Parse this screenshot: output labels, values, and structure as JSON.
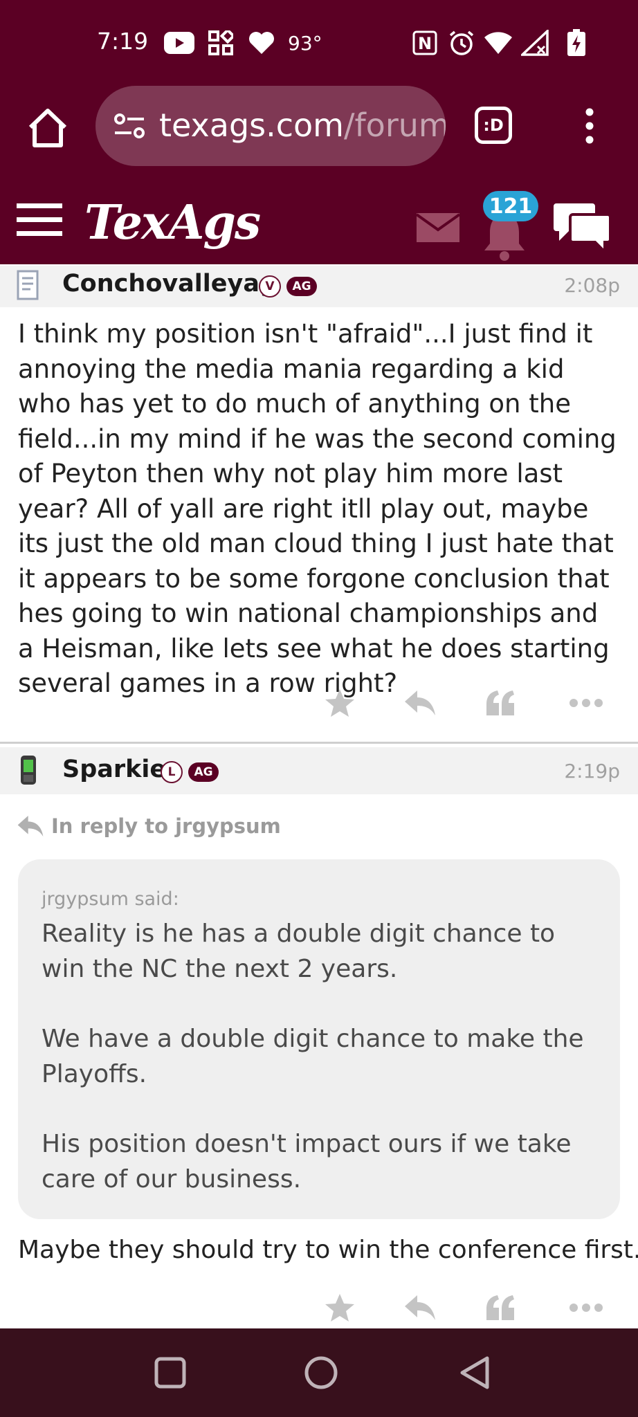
{
  "status_bar": {
    "time": "7:19",
    "temperature": "93°"
  },
  "browser": {
    "url_domain": "texags.com",
    "url_path": "/forum",
    "tab_label": ":D"
  },
  "app": {
    "logo": "TexAgs",
    "notification_count": "121"
  },
  "posts": [
    {
      "username": "Conchovalleyag",
      "badge_letter": "V",
      "badge_tag": "AG",
      "time": "2:08p",
      "body": "I think my position isn't \"afraid\"...I just find it annoying the media mania regarding a kid who has yet to do much of anything on the field...in my mind if he was the second coming of Peyton then why not play him more last year? All of yall are right itll play out, maybe its just the old man cloud thing I just hate that it appears to be some forgone conclusion that hes going to win national championships and a Heisman, like lets see what he does starting several games in a row right?"
    },
    {
      "username": "Sparkie",
      "badge_letter": "L",
      "badge_tag": "AG",
      "time": "2:19p",
      "reply_to": "In reply to jrgypsum",
      "quote_author": "jrgypsum said:",
      "quote_paragraphs": [
        "Reality is he has a double digit chance to win the NC the next 2 years.",
        "We have a double digit chance to make the Playoffs.",
        "His position doesn't impact ours if we take care of our business."
      ],
      "body": "Maybe they should try to win the conference first."
    }
  ],
  "colors": {
    "maroon": "#5b0024",
    "badge_blue": "#2aa3d6",
    "nav_bar": "#38101c"
  }
}
